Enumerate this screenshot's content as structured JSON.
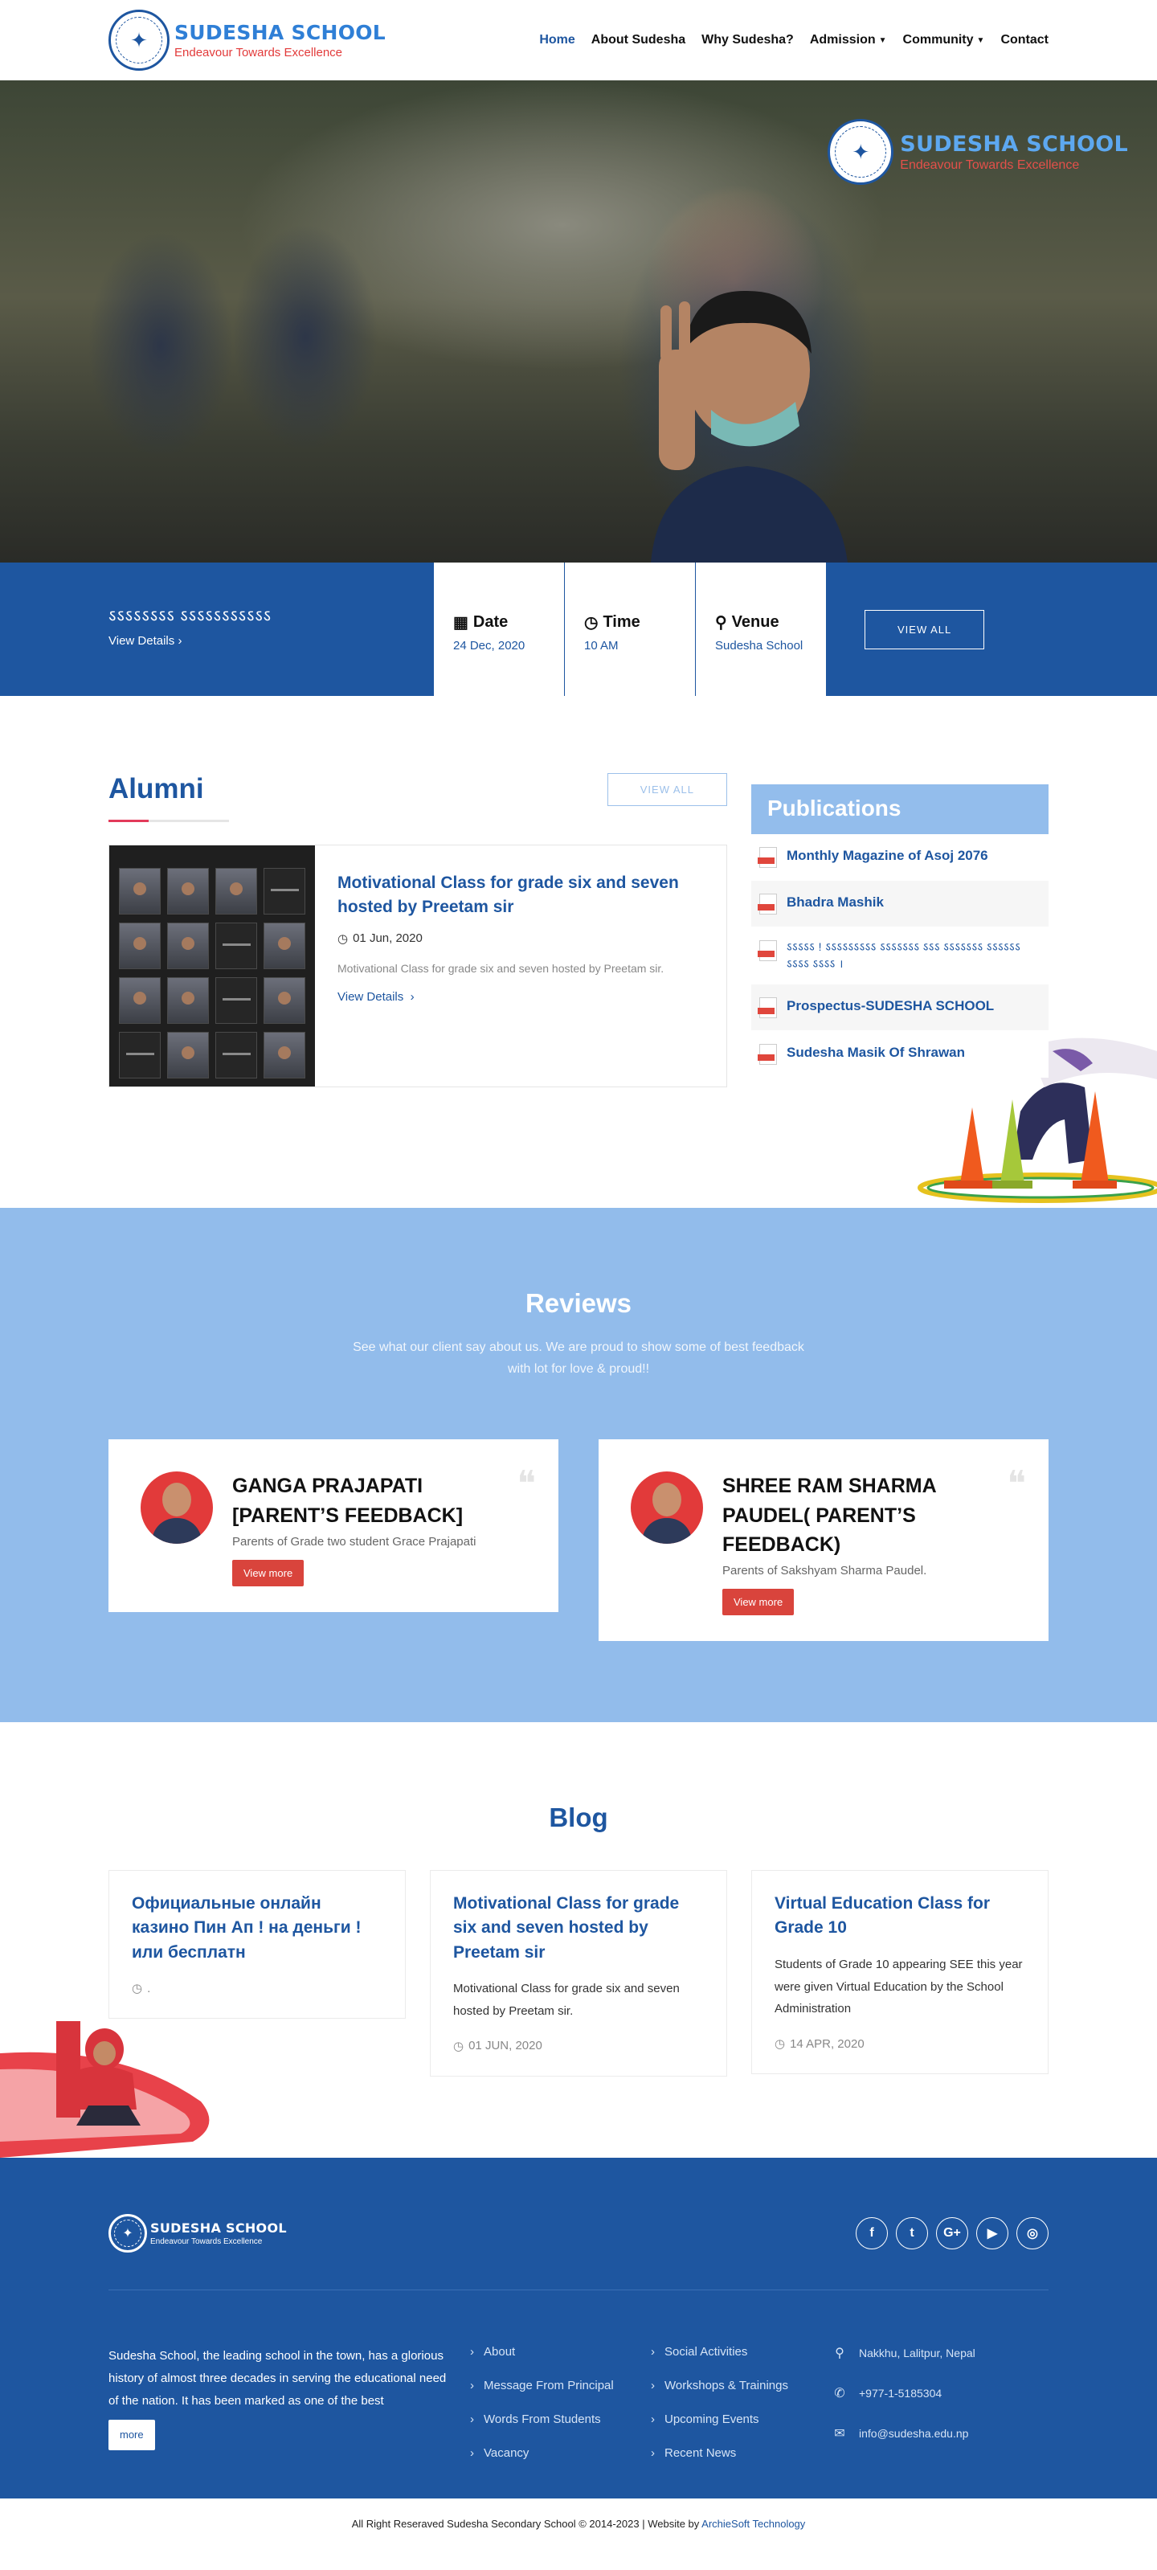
{
  "brand": {
    "name": "SUDESHA SCHOOL",
    "tagline": "Endeavour Towards Excellence",
    "primary_color": "#1e56a0",
    "light_color": "#93bdec",
    "accent_red": "#d9443c"
  },
  "nav": {
    "items": [
      {
        "label": "Home"
      },
      {
        "label": "About Sudesha"
      },
      {
        "label": "Why Sudesha?"
      },
      {
        "label": "Admission"
      },
      {
        "label": "Community"
      },
      {
        "label": "Contact"
      }
    ]
  },
  "event": {
    "title": "ऽऽऽऽऽऽऽऽ ऽऽऽऽऽऽऽऽऽऽऽ",
    "link": "View Details",
    "date_label": "Date",
    "date_value": "24 Dec, 2020",
    "time_label": "Time",
    "time_value": "10 AM",
    "venue_label": "Venue",
    "venue_value": "Sudesha School",
    "view_all": "VIEW ALL"
  },
  "alumni": {
    "title": "Alumni",
    "view_all": "VIEW ALL",
    "card": {
      "title": "Motivational Class for grade six and seven hosted by Preetam sir",
      "date": "01 Jun, 2020",
      "description": "Motivational Class for grade six and seven hosted by Preetam sir.",
      "link": "View Details"
    }
  },
  "publications": {
    "title": "Publications",
    "items": [
      {
        "label": "Monthly Magazine of Asoj 2076"
      },
      {
        "label": "Bhadra Mashik"
      },
      {
        "label": "ऽऽऽऽऽ ! ऽऽऽऽऽऽऽऽऽ ऽऽऽऽऽऽऽ ऽऽऽ ऽऽऽऽऽऽऽ ऽऽऽऽऽऽ ऽऽऽऽ ऽऽऽऽ ।"
      },
      {
        "label": "Prospectus-SUDESHA SCHOOL"
      },
      {
        "label": "Sudesha Masik Of Shrawan"
      }
    ]
  },
  "reviews": {
    "title": "Reviews",
    "subtitle": "See what our client say about us. We are proud to show some of best feedback with lot for love & proud!!",
    "items": [
      {
        "name": "GANGA PRAJAPATI [PARENT’S FEEDBACK]",
        "role": "Parents of Grade two student Grace Prajapati",
        "button": "View more"
      },
      {
        "name": "SHREE RAM SHARMA PAUDEL( PARENT’S FEEDBACK)",
        "role": "Parents of Sakshyam Sharma Paudel.",
        "button": "View more"
      }
    ]
  },
  "blog": {
    "title": "Blog",
    "items": [
      {
        "title": "Официальные онлайн казино Пин Ап ! на деньги ! или бесплатн",
        "excerpt": "",
        "date": "."
      },
      {
        "title": "Motivational Class for grade six and seven hosted by Preetam sir",
        "excerpt": "Motivational Class for grade six and seven hosted by Preetam sir.",
        "date": "01 JUN, 2020"
      },
      {
        "title": "Virtual Education Class for Grade 10",
        "excerpt": "Students of Grade 10 appearing SEE this year were given Virtual Education by the School Administration",
        "date": "14 APR, 2020"
      }
    ]
  },
  "footer": {
    "about": "Sudesha School, the leading school in the town, has a glorious history of almost three decades in serving the educational need of the nation. It has been marked as one of the best",
    "more": "more",
    "col1": [
      {
        "label": "About"
      },
      {
        "label": "Message From Principal"
      },
      {
        "label": "Words From Students"
      },
      {
        "label": "Vacancy"
      }
    ],
    "col2": [
      {
        "label": "Social Activities"
      },
      {
        "label": "Workshops & Trainings"
      },
      {
        "label": "Upcoming Events"
      },
      {
        "label": "Recent News"
      }
    ],
    "contact": {
      "address": "Nakkhu, Lalitpur, Nepal",
      "phone": "+977-1-5185304",
      "email": "info@sudesha.edu.np"
    },
    "socials": [
      {
        "icon": "facebook-icon",
        "glyph": "f"
      },
      {
        "icon": "twitter-icon",
        "glyph": "t"
      },
      {
        "icon": "google-plus-icon",
        "glyph": "G+"
      },
      {
        "icon": "youtube-icon",
        "glyph": "▶"
      },
      {
        "icon": "instagram-icon",
        "glyph": "◎"
      }
    ]
  },
  "copyright": {
    "text": "All Right Reseraved Sudesha Secondary School © 2014-2023 | Website by ",
    "brand": "ArchieSoft Technology"
  }
}
